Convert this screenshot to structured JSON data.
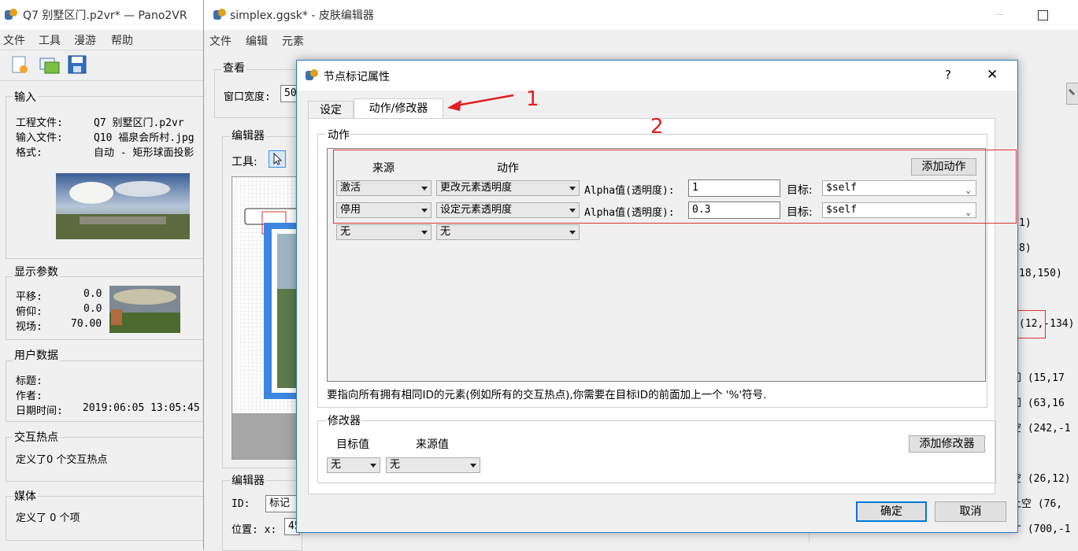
{
  "left_window": {
    "title": "Q7 别墅区门.p2vr* — Pano2VR",
    "menu": [
      "文件",
      "工具",
      "漫游",
      "帮助"
    ],
    "input_group": {
      "title": "输入",
      "project_label": "工程文件:",
      "project_value": "Q7 别墅区门.p2vr",
      "input_label": "输入文件:",
      "input_value": "Q10 福泉会所村.jpg",
      "format_label": "格式:",
      "format_value": "自动 - 矩形球面投影"
    },
    "display_group": {
      "title": "显示参数",
      "pan_label": "平移:",
      "pan_value": "0.0",
      "tilt_label": "俯仰:",
      "tilt_value": "0.0",
      "fov_label": "视场:",
      "fov_value": "70.00"
    },
    "user_group": {
      "title": "用户数据",
      "title_label": "标题:",
      "author_label": "作者:",
      "datetime_label": "日期时间:",
      "datetime_value": "2019:06:05 13:05:45"
    },
    "hotspot_group": {
      "title": "交互热点",
      "text": "定义了0 个交互热点"
    },
    "media_group": {
      "title": "媒体",
      "text": "定义了 0 个项"
    }
  },
  "mid_window": {
    "title": "simplex.ggsk* - 皮肤编辑器",
    "menu": [
      "文件",
      "编辑",
      "元素"
    ],
    "view_group_title": "查看",
    "window_width_label": "窗口宽度:",
    "window_width_value": "50",
    "editor_group_title": "编辑器",
    "tools_label": "工具:",
    "editor2_title": "编辑器",
    "id_label": "ID:",
    "id_value": "标记",
    "pos_label": "位置: x:",
    "pos_x_value": "45",
    "tree_items": [
      "1)",
      "8)",
      "18,150)",
      "(12,-134)",
      "门 (15,17",
      "门 (63,16",
      "空 (242,-1",
      "空 (26,12)",
      "上空 (76,",
      "才 (700,-1"
    ]
  },
  "dialog": {
    "title": "节点标记属性",
    "help": "?",
    "close": "✕",
    "tabs": [
      "设定",
      "动作/修改器"
    ],
    "actions_group_title": "动作",
    "col_source": "来源",
    "col_action": "动作",
    "add_action_button": "添加动作",
    "rows": [
      {
        "source": "激活",
        "action": "更改元素透明度",
        "param_label": "Alpha值(透明度):",
        "param_value": "1",
        "target_label": "目标:",
        "target_value": "$self"
      },
      {
        "source": "停用",
        "action": "设定元素透明度",
        "param_label": "Alpha值(透明度):",
        "param_value": "0.3",
        "target_label": "目标:",
        "target_value": "$self"
      },
      {
        "source": "无",
        "action": "无"
      }
    ],
    "hint": "要指向所有拥有相同ID的元素(例如所有的交互热点),你需要在目标ID的前面加上一个 '%'符号.",
    "modifier_group_title": "修改器",
    "col_target_value": "目标值",
    "col_source_value": "来源值",
    "add_modifier_button": "添加修改器",
    "modifier_row": {
      "target": "无",
      "source": "无"
    },
    "ok_button": "确定",
    "cancel_button": "取消"
  },
  "annotations": {
    "one": "1",
    "two": "2",
    "color": "#e02020"
  }
}
